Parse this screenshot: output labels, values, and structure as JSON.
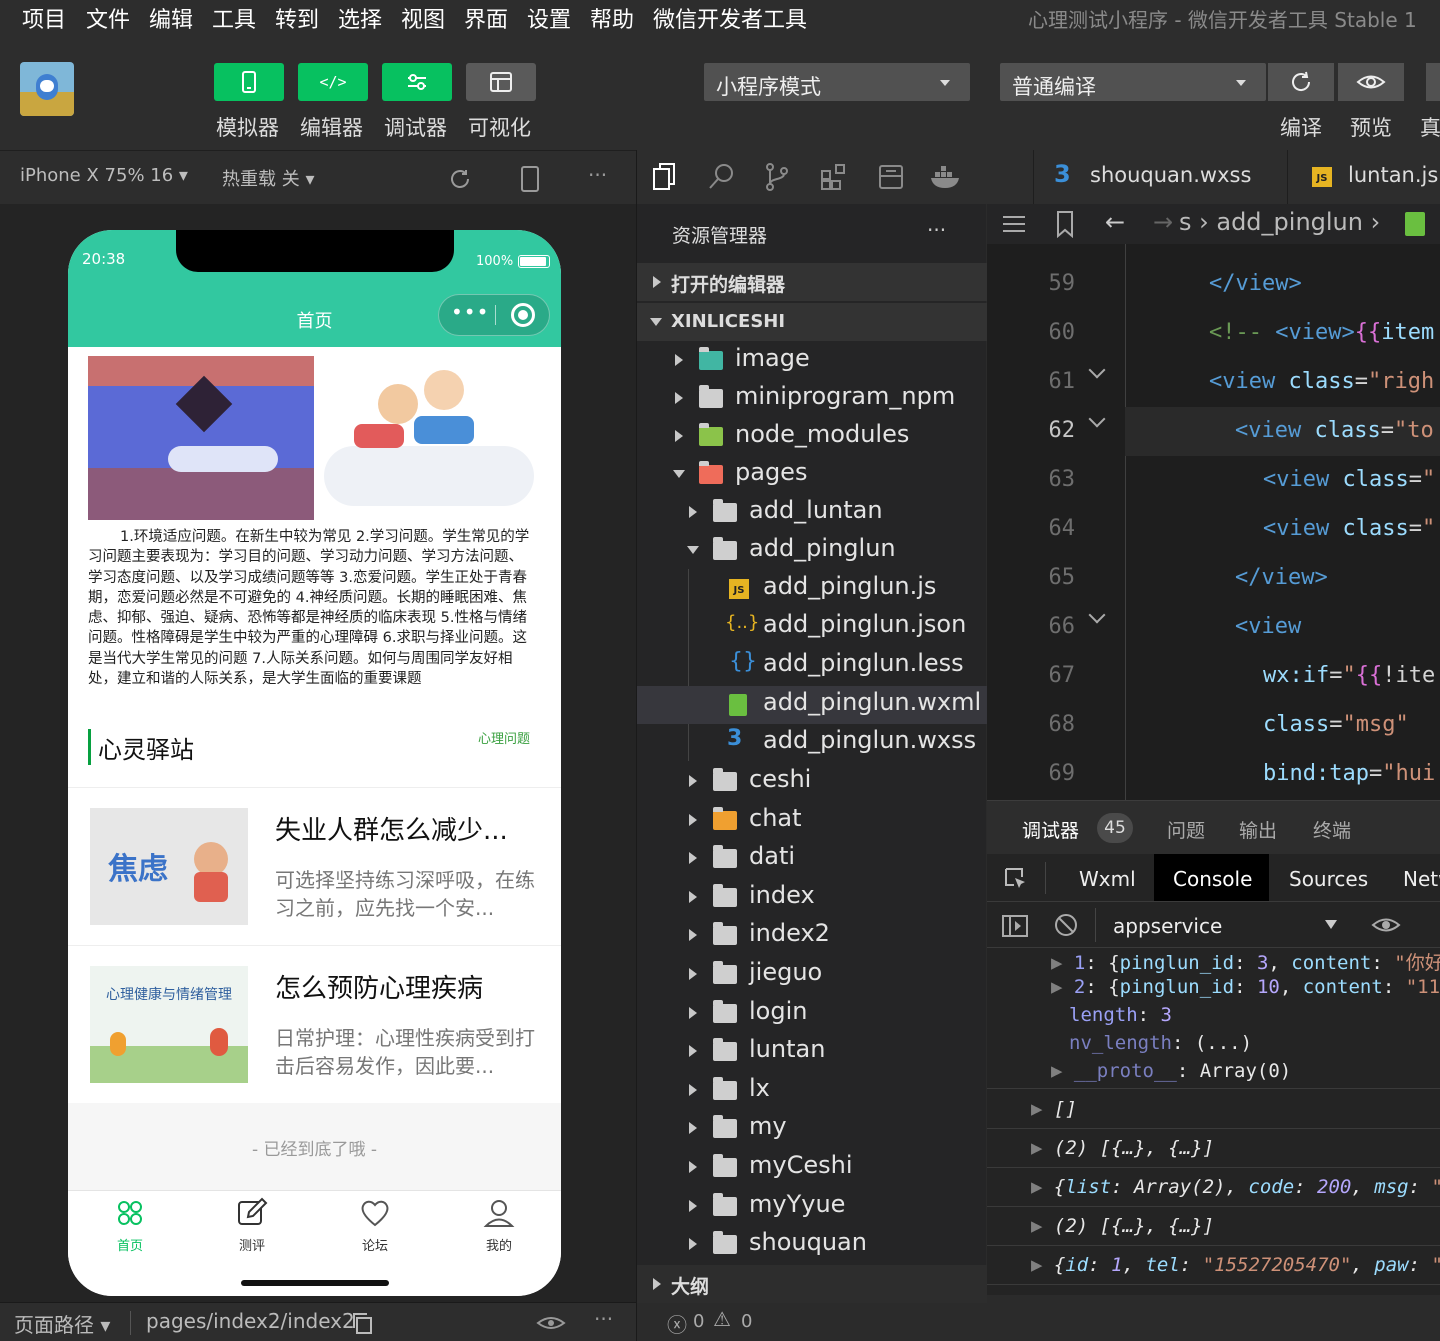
{
  "menu": [
    "项目",
    "文件",
    "编辑",
    "工具",
    "转到",
    "选择",
    "视图",
    "界面",
    "设置",
    "帮助",
    "微信开发者工具"
  ],
  "window_title": "心理测试小程序 - 微信开发者工具 Stable 1",
  "toolbar": {
    "buttons": [
      {
        "label": "模拟器",
        "icon": "phone-icon"
      },
      {
        "label": "编辑器",
        "icon": "code-icon"
      },
      {
        "label": "调试器",
        "icon": "sliders-icon"
      },
      {
        "label": "可视化",
        "icon": "layout-icon"
      }
    ],
    "mode_select": "小程序模式",
    "compile_select": "普通编译",
    "compile_label": "编译",
    "preview_label": "预览",
    "real_label": "真"
  },
  "sim": {
    "device": "iPhone X 75% 16 ▾",
    "hot_reload": "热重载 关 ▾",
    "path_label": "页面路径 ▾",
    "path": "pages/index2/index2"
  },
  "phone": {
    "time": "20:38",
    "battery": "100%",
    "nav_title": "首页",
    "intro": "1.环境适应问题。在新生中较为常见 2.学习问题。学生常见的学习问题主要表现为：学习目的问题、学习动力问题、学习方法问题、学习态度问题、以及学习成绩问题等等 3.恋爱问题。学生正处于青春期，恋爱问题必然是不可避免的 4.神经质问题。长期的睡眠困难、焦虑、抑郁、强迫、疑病、恐怖等都是神经质的临床表现 5.性格与情绪问题。性格障碍是学生中较为严重的心理障碍 6.求职与择业问题。这是当代大学生常见的问题 7.人际关系问题。如何与周围同学友好相处，建立和谐的人际关系，是大学生面临的重要课题",
    "section_title": "心灵驿站",
    "section_link": "心理问题",
    "articles": [
      {
        "title": "失业人群怎么减少...",
        "summary": "可选择坚持练习深呼吸，在练习之前，应先找一个安...",
        "thumb_text": "焦虑"
      },
      {
        "title": "怎么预防心理疾病",
        "summary": "日常护理：心理性疾病受到打击后容易发作，因此要...",
        "thumb_text": "心理健康与情绪管理"
      }
    ],
    "end_text": "- 已经到底了哦 -",
    "tabbar": [
      {
        "label": "首页",
        "icon": "home-icon"
      },
      {
        "label": "测评",
        "icon": "edit-icon"
      },
      {
        "label": "论坛",
        "icon": "heart-icon"
      },
      {
        "label": "我的",
        "icon": "user-icon"
      }
    ]
  },
  "explorer": {
    "title": "资源管理器",
    "open_editors": "打开的编辑器",
    "project": "XINLICESHI",
    "outline": "大纲",
    "errors": "0",
    "warnings": "0",
    "root_items": [
      "image",
      "miniprogram_npm",
      "node_modules",
      "pages"
    ],
    "pages_items": [
      "add_luntan",
      "add_pinglun"
    ],
    "files": [
      "add_pinglun.js",
      "add_pinglun.json",
      "add_pinglun.less",
      "add_pinglun.wxml",
      "add_pinglun.wxss"
    ],
    "more_pages": [
      "ceshi",
      "chat",
      "dati",
      "index",
      "index2",
      "jieguo",
      "login",
      "luntan",
      "lx",
      "my",
      "myCeshi",
      "myYyue",
      "shouquan"
    ]
  },
  "editor": {
    "tabs": [
      "shouquan.wxss",
      "luntan.js"
    ],
    "breadcrumb": "s › add_pinglun ›",
    "lines": [
      "59",
      "60",
      "61",
      "62",
      "63",
      "64",
      "65",
      "66",
      "67",
      "68",
      "69"
    ]
  },
  "devtools": {
    "tabs": [
      "调试器",
      "问题",
      "输出",
      "终端"
    ],
    "badge": "45",
    "panels": [
      "Wxml",
      "Console",
      "Sources",
      "Netw"
    ],
    "context": "appservice",
    "log": [
      "▶ 1: {pinglun_id: 3, content: \"你好",
      "▶ 2: {pinglun_id: 10, content: \"11",
      "length: 3",
      "nv_length: (...)",
      "▶ __proto__: Array(0)",
      "▶ []",
      "▶ (2) [{…}, {…}]",
      "▶ {list: Array(2), code: 200, msg: \"",
      "▶ (2) [{…}, {…}]",
      "▶ {id: 1, tel: \"15527205470\", paw: \""
    ]
  }
}
